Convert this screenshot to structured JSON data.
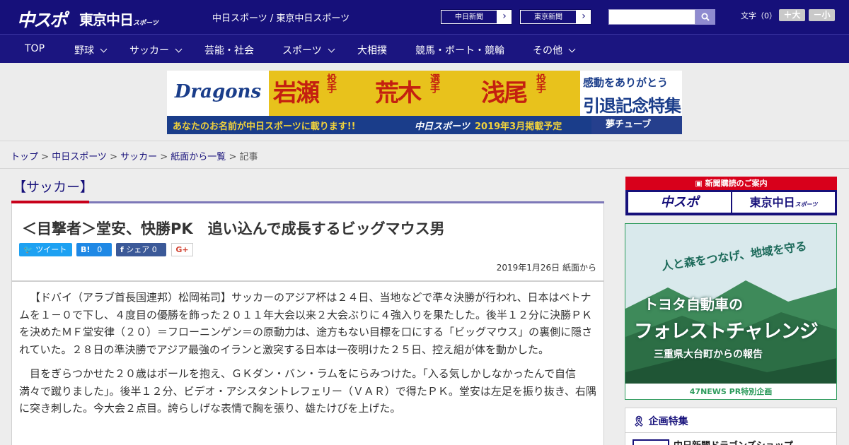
{
  "header": {
    "logo_chuspo": "中スポ",
    "logo_tokyo": "東京中日",
    "logo_tokyo_small": "スポーツ",
    "site_title": "中日スポーツ / 東京中日スポーツ",
    "paper_links": [
      "中日新聞",
      "東京新聞"
    ],
    "search_placeholder": "",
    "font_label": "文字（0）",
    "font_larger": "＋大",
    "font_smaller": "－小",
    "bg_color": "#16107a"
  },
  "nav": {
    "items": [
      {
        "label": "TOP",
        "has_menu": false
      },
      {
        "label": "野球",
        "has_menu": true
      },
      {
        "label": "サッカー",
        "has_menu": true
      },
      {
        "label": "芸能・社会",
        "has_menu": false
      },
      {
        "label": "スポーツ",
        "has_menu": true
      },
      {
        "label": "大相撲",
        "has_menu": false
      },
      {
        "label": "競馬・ボート・競輪",
        "has_menu": false
      },
      {
        "label": "その他",
        "has_menu": true
      }
    ]
  },
  "banner": {
    "logo": "Dragons",
    "names": [
      "岩瀬",
      "荒木",
      "浅尾"
    ],
    "subs": [
      "投手",
      "選手",
      "投手"
    ],
    "right_1": "感動をありがとう",
    "right_2": "引退記念特集",
    "strip_1": "あなたのお名前が中日スポーツに載ります!!",
    "strip_2": "中日スポーツ",
    "strip_3": "2019年3月掲載予定",
    "strip_4": "夢チューブ"
  },
  "breadcrumb": {
    "items": [
      "トップ",
      "中日スポーツ",
      "サッカー",
      "紙面から一覧"
    ],
    "current": "記事"
  },
  "article": {
    "category": "【サッカー】",
    "headline": "＜目撃者＞堂安、快勝PK　追い込んで成長するビッグマウス男",
    "share": {
      "tweet": "ツイート",
      "hatena": "B!",
      "hatena_count": "0",
      "facebook": "シェア",
      "facebook_count": "0",
      "gplus": "G+"
    },
    "date": "2019年1月26日 紙面から",
    "paragraphs": [
      "【ドバイ（アラブ首長国連邦）松岡祐司】サッカーのアジア杯は２４日、当地などで準々決勝が行われ、日本はベトナムを１－０で下し、４度目の優勝を飾った２０１１年大会以来２大会ぶりに４強入りを果たした。後半１２分に決勝ＰＫを決めたＭＦ堂安律（２０）＝フローニンゲン＝の原動力は、途方もない目標を口にする「ビッグマウス」の裏側に隠されていた。２８日の準決勝でアジア最強のイランと激突する日本は一夜明けた２５日、控え組が体を動かした。",
      "目をぎらつかせた２０歳はボールを抱え、ＧＫダン・バン・ラムをにらみつけた。「入る気しかしなかったんで自信満々で蹴りました」。後半１２分、ビデオ・アシスタントレフェリー（ＶＡＲ）で得たＰＫ。堂安は左足を振り抜き、右隅に突き刺した。今大会２点目。誇らしげな表情で胸を張り、雄たけびを上げた。"
    ]
  },
  "sidebar": {
    "subscribe_head": "新聞購読のご案内",
    "subscribe_buttons": [
      "中スポ",
      "東京中日"
    ],
    "subscribe_small": "スポーツ",
    "ad": {
      "t1": "人と森をつなげ、地域を守る",
      "t2": "トヨタ自動車の",
      "t3": "フォレストチャレンジ",
      "t4": "三重県大台町からの報告",
      "foot": "47NEWS PR特別企画"
    },
    "feature_head": "企画特集",
    "feature_item": "中日新聞ドラゴンズショップ"
  }
}
